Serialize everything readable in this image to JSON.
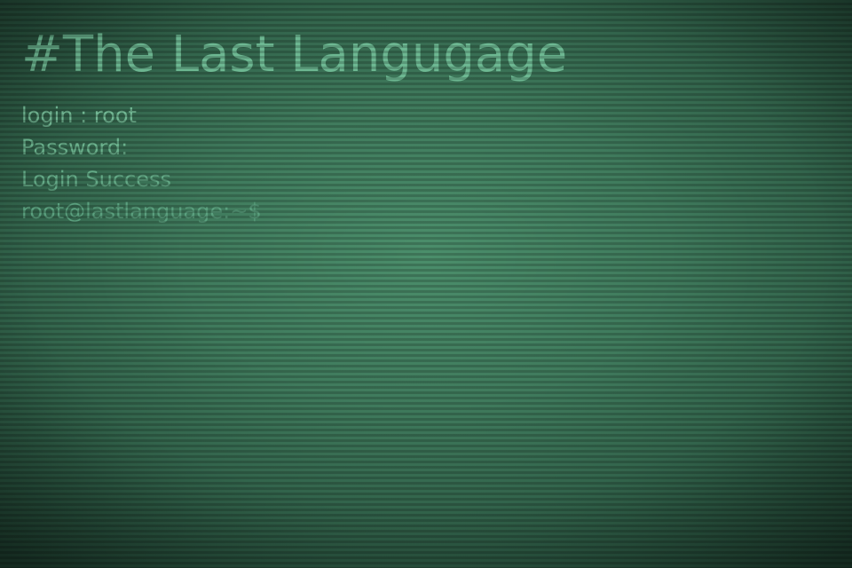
{
  "app": {
    "title": "#The Last Langugage"
  },
  "terminal": {
    "lines": [
      "login : root",
      "Password:",
      "Login Success"
    ],
    "prompt": "root@lastlanguage:~$"
  },
  "colors": {
    "background_center": "#4b8e6b",
    "background_edge": "#1c3a2c",
    "text": "#6db892"
  }
}
